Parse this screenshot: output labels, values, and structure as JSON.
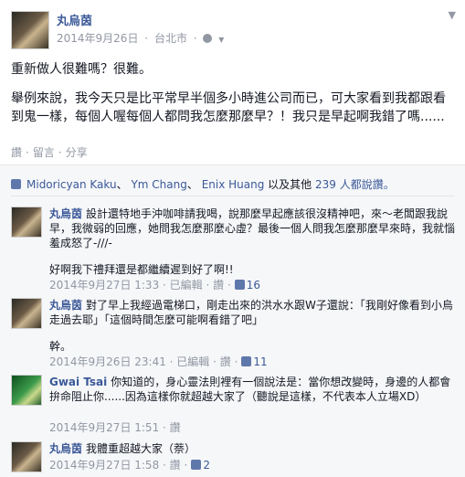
{
  "post": {
    "author": "丸烏茵",
    "date": "2014年9月26日",
    "sep": "·",
    "location": "台北市",
    "body_p1": "重新做人很難嗎？很難。",
    "body_p2": "舉例來說，我今天只是比平常早半個多小時進公司而已，可大家看到我都跟看到鬼一樣，每個人喔每個人都問我怎麼那麼早？！我只是早起啊我錯了嗎......",
    "actions": [
      "讚",
      "留言",
      "分享"
    ]
  },
  "likes_summary": {
    "names": [
      "Midoricyan Kaku",
      "Ym Chang",
      "Enix Huang"
    ],
    "sep": "、",
    "suffix_pre": " 以及其他 ",
    "others_count": "239",
    "suffix_post": " 人都說讚。"
  },
  "comments": [
    {
      "name": "丸烏茵",
      "text": "設計還特地手沖咖啡請我喝，說那麼早起應該很沒精神吧，來～老闆跟我說早，我微弱的回應，她問我怎麼那麼心虛？最後一個人問我怎麼那麼早來時，我就惱羞成怒了-///-",
      "extra": "好啊我下禮拜還是都繼續遲到好了啊!!",
      "time": "2014年9月27日 1:33",
      "edited": "已編輯",
      "like_label": "讚",
      "likes": "16"
    },
    {
      "name": "丸烏茵",
      "text": "對了早上我經過電梯口，剛走出來的洪水水跟W子還說：「我剛好像看到小烏走過去耶」「這個時間怎麼可能啊看錯了吧」",
      "extra": "幹。",
      "time": "2014年9月26日 23:41",
      "edited": "已編輯",
      "like_label": "讚",
      "likes": "11"
    },
    {
      "name": "Gwai Tsai",
      "text": "你知道的，身心靈法則裡有一個說法是：當你想改變時，身邊的人都會拚命阻止你......因為這樣你就超越大家了（聽說是這樣，不代表本人立場XD）",
      "extra": "",
      "time": "2014年9月27日 1:51",
      "edited": "",
      "like_label": "讚",
      "likes": ""
    },
    {
      "name": "丸烏茵",
      "text": "我體重超越大家（萘）",
      "extra": "",
      "time": "2014年9月27日 1:58",
      "edited": "",
      "like_label": "讚",
      "likes": "2"
    }
  ]
}
